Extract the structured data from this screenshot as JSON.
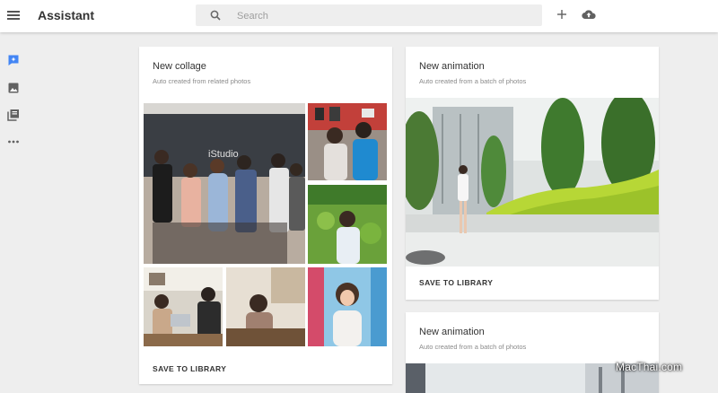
{
  "header": {
    "app_title": "Assistant",
    "search_placeholder": "Search"
  },
  "sidebar": {
    "items": [
      {
        "name": "assistant",
        "icon": "assistant-icon",
        "active": true
      },
      {
        "name": "photos",
        "icon": "photo-icon"
      },
      {
        "name": "albums",
        "icon": "albums-icon"
      },
      {
        "name": "more",
        "icon": "more-horiz-icon"
      }
    ]
  },
  "cards": [
    {
      "title": "New collage",
      "subtitle": "Auto created from related photos",
      "action": "SAVE TO LIBRARY"
    },
    {
      "title": "New animation",
      "subtitle": "Auto created from a batch of photos",
      "action": "SAVE TO LIBRARY"
    },
    {
      "title": "New animation",
      "subtitle": "Auto created from a batch of photos"
    }
  ],
  "watermark": "MacThai.com",
  "colors": {
    "accent": "#4285f4",
    "background": "#eeeeee",
    "card": "#ffffff",
    "header": "#ffffff"
  }
}
